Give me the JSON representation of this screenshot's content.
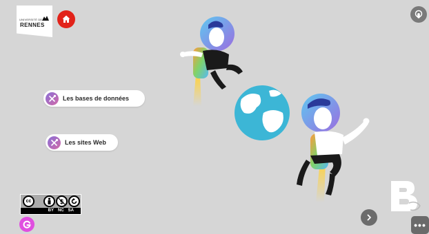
{
  "branding": {
    "university_small": "UNIVERSITÉ DE",
    "university_name": "RENNES"
  },
  "buttons": {
    "home_icon": "home-icon",
    "top_right_icon": "touch-icon",
    "next_icon": "chevron-right-icon",
    "menu_label": "•••"
  },
  "links": [
    {
      "label": "Les bases de données",
      "icon": "tools-icon"
    },
    {
      "label": "Les sites Web",
      "icon": "tools-icon"
    }
  ],
  "license": {
    "cc": "cc",
    "labels": [
      "BY",
      "NC",
      "SA"
    ]
  },
  "colors": {
    "background": "#d6d6d6",
    "home_button": "#e2231a",
    "genially_button": "#e04fe0",
    "pill_icon_gradient_start": "#8a6fd6",
    "pill_icon_gradient_end": "#d26aa8"
  }
}
